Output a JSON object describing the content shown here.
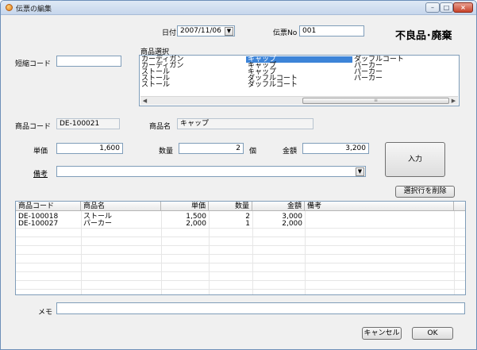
{
  "window": {
    "title": "伝票の編集"
  },
  "caption_buttons": {
    "minimize": "–",
    "maximize": "□",
    "close": "×"
  },
  "header": {
    "date_label": "日付",
    "date_value": "2007/11/06",
    "slip_no_label": "伝票No",
    "slip_no_value": "001",
    "category_badge": "不良品･廃棄"
  },
  "short_code": {
    "label": "短縮コード",
    "value": ""
  },
  "product_select": {
    "label": "商品選択",
    "columns": [
      [
        "カーディガン",
        "カーディガン",
        "ストール",
        "ストール",
        "ストール"
      ],
      [
        "キャップ",
        "キャップ",
        "キャップ",
        "ダッフルコート",
        "ダッフルコート"
      ],
      [
        "ダッフルコート",
        "パーカー",
        "パーカー",
        "パーカー"
      ]
    ],
    "selected": {
      "column": 1,
      "row": 0
    }
  },
  "product_code": {
    "label": "商品コード",
    "value": "DE-100021"
  },
  "product_name": {
    "label": "商品名",
    "value": "キャップ"
  },
  "unit_price": {
    "label": "単価",
    "value": "1,600"
  },
  "quantity": {
    "label": "数量",
    "value": "2",
    "unit": "個"
  },
  "amount": {
    "label": "金額",
    "value": "3,200"
  },
  "remarks": {
    "label": "備考",
    "value": ""
  },
  "buttons": {
    "input": "入力",
    "delete_selected": "選択行を削除",
    "cancel": "キャンセル",
    "ok": "OK"
  },
  "grid": {
    "headers": [
      "商品コード",
      "商品名",
      "単価",
      "数量",
      "金額",
      "備考"
    ],
    "rows": [
      [
        "DE-100018",
        "ストール",
        "1,500",
        "2",
        "3,000",
        ""
      ],
      [
        "DE-100027",
        "パーカー",
        "2,000",
        "1",
        "2,000",
        ""
      ]
    ]
  },
  "memo": {
    "label": "メモ",
    "value": ""
  }
}
